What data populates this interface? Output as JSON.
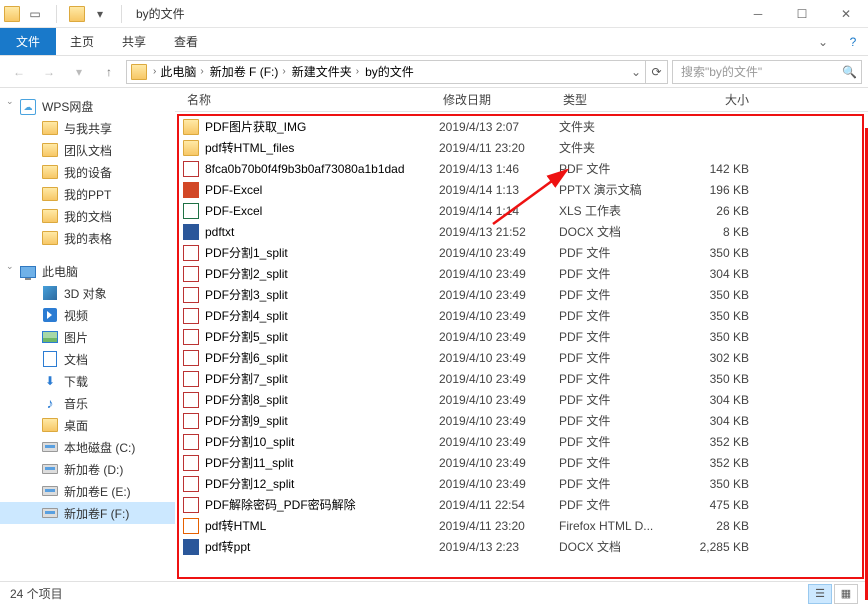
{
  "window": {
    "title": "by的文件"
  },
  "ribbon": {
    "file": "文件",
    "tabs": [
      "主页",
      "共享",
      "查看"
    ]
  },
  "address": {
    "segments": [
      "此电脑",
      "新加卷 F (F:)",
      "新建文件夹",
      "by的文件"
    ]
  },
  "search": {
    "placeholder": "搜索\"by的文件\""
  },
  "nav": {
    "wps": {
      "label": "WPS网盘"
    },
    "quick": [
      {
        "label": "与我共享",
        "icon": "folder"
      },
      {
        "label": "团队文档",
        "icon": "folder"
      },
      {
        "label": "我的设备",
        "icon": "folder"
      },
      {
        "label": "我的PPT",
        "icon": "folder"
      },
      {
        "label": "我的文档",
        "icon": "folder"
      },
      {
        "label": "我的表格",
        "icon": "folder"
      }
    ],
    "thispc": {
      "label": "此电脑"
    },
    "pc_items": [
      {
        "label": "3D 对象",
        "icon": "3d"
      },
      {
        "label": "视频",
        "icon": "vid"
      },
      {
        "label": "图片",
        "icon": "img"
      },
      {
        "label": "文档",
        "icon": "doc"
      },
      {
        "label": "下载",
        "icon": "dl"
      },
      {
        "label": "音乐",
        "icon": "music"
      },
      {
        "label": "桌面",
        "icon": "folder"
      },
      {
        "label": "本地磁盘 (C:)",
        "icon": "drive"
      },
      {
        "label": "新加卷 (D:)",
        "icon": "drive"
      },
      {
        "label": "新加卷E (E:)",
        "icon": "drive"
      },
      {
        "label": "新加卷F (F:)",
        "icon": "drive",
        "selected": true
      }
    ]
  },
  "columns": {
    "name": "名称",
    "date": "修改日期",
    "type": "类型",
    "size": "大小"
  },
  "files": [
    {
      "name": "PDF图片获取_IMG",
      "date": "2019/4/13 2:07",
      "type": "文件夹",
      "size": "",
      "icon": "folder"
    },
    {
      "name": "pdf转HTML_files",
      "date": "2019/4/11 23:20",
      "type": "文件夹",
      "size": "",
      "icon": "folder"
    },
    {
      "name": "8fca0b70b0f4f9b3b0af73080a1b1dad",
      "date": "2019/4/13 1:46",
      "type": "PDF 文件",
      "size": "142 KB",
      "icon": "pdf"
    },
    {
      "name": "PDF-Excel",
      "date": "2019/4/14 1:13",
      "type": "PPTX 演示文稿",
      "size": "196 KB",
      "icon": "ppt"
    },
    {
      "name": "PDF-Excel",
      "date": "2019/4/14 1:14",
      "type": "XLS 工作表",
      "size": "26 KB",
      "icon": "xls"
    },
    {
      "name": "pdftxt",
      "date": "2019/4/13 21:52",
      "type": "DOCX 文档",
      "size": "8 KB",
      "icon": "docx"
    },
    {
      "name": "PDF分割1_split",
      "date": "2019/4/10 23:49",
      "type": "PDF 文件",
      "size": "350 KB",
      "icon": "pdf"
    },
    {
      "name": "PDF分割2_split",
      "date": "2019/4/10 23:49",
      "type": "PDF 文件",
      "size": "304 KB",
      "icon": "pdf"
    },
    {
      "name": "PDF分割3_split",
      "date": "2019/4/10 23:49",
      "type": "PDF 文件",
      "size": "350 KB",
      "icon": "pdf"
    },
    {
      "name": "PDF分割4_split",
      "date": "2019/4/10 23:49",
      "type": "PDF 文件",
      "size": "350 KB",
      "icon": "pdf"
    },
    {
      "name": "PDF分割5_split",
      "date": "2019/4/10 23:49",
      "type": "PDF 文件",
      "size": "350 KB",
      "icon": "pdf"
    },
    {
      "name": "PDF分割6_split",
      "date": "2019/4/10 23:49",
      "type": "PDF 文件",
      "size": "302 KB",
      "icon": "pdf"
    },
    {
      "name": "PDF分割7_split",
      "date": "2019/4/10 23:49",
      "type": "PDF 文件",
      "size": "350 KB",
      "icon": "pdf"
    },
    {
      "name": "PDF分割8_split",
      "date": "2019/4/10 23:49",
      "type": "PDF 文件",
      "size": "304 KB",
      "icon": "pdf"
    },
    {
      "name": "PDF分割9_split",
      "date": "2019/4/10 23:49",
      "type": "PDF 文件",
      "size": "304 KB",
      "icon": "pdf"
    },
    {
      "name": "PDF分割10_split",
      "date": "2019/4/10 23:49",
      "type": "PDF 文件",
      "size": "352 KB",
      "icon": "pdf"
    },
    {
      "name": "PDF分割11_split",
      "date": "2019/4/10 23:49",
      "type": "PDF 文件",
      "size": "352 KB",
      "icon": "pdf"
    },
    {
      "name": "PDF分割12_split",
      "date": "2019/4/10 23:49",
      "type": "PDF 文件",
      "size": "350 KB",
      "icon": "pdf"
    },
    {
      "name": "PDF解除密码_PDF密码解除",
      "date": "2019/4/11 22:54",
      "type": "PDF 文件",
      "size": "475 KB",
      "icon": "pdf"
    },
    {
      "name": "pdf转HTML",
      "date": "2019/4/11 23:20",
      "type": "Firefox HTML D...",
      "size": "28 KB",
      "icon": "html"
    },
    {
      "name": "pdf转ppt",
      "date": "2019/4/13 2:23",
      "type": "DOCX 文档",
      "size": "2,285 KB",
      "icon": "docx"
    }
  ],
  "status": {
    "count": "24 个项目"
  }
}
